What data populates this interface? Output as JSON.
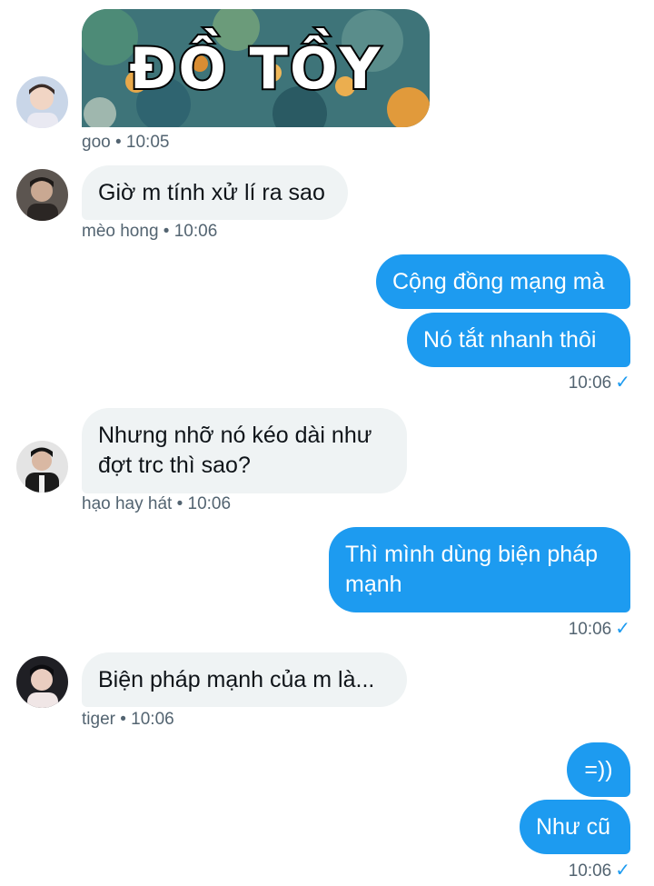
{
  "colors": {
    "outgoing_bubble": "#1d9bf0",
    "incoming_bubble": "#eff3f4",
    "meta_text": "#536471",
    "read_check": "#1d9bf0"
  },
  "messages": [
    {
      "kind": "sticker",
      "sender": "goo",
      "sticker_text": "ĐỒ TỒY",
      "meta": "goo • 10:05",
      "avatar_icon": "user-avatar-icon"
    },
    {
      "kind": "incoming",
      "sender": "mèo hong",
      "text": "Giờ m tính xử lí ra sao",
      "meta": "mèo hong • 10:06",
      "avatar_icon": "user-avatar-icon"
    },
    {
      "kind": "outgoing",
      "text": "Cộng đồng mạng mà"
    },
    {
      "kind": "outgoing",
      "text": "Nó tắt nhanh thôi",
      "time": "10:06",
      "status_icon": "check-icon"
    },
    {
      "kind": "incoming",
      "sender": "hạo hay hát",
      "text_line1": "Nhưng nhỡ nó kéo dài như",
      "text_line2": "đợt trc thì sao?",
      "meta": "hạo hay hát • 10:06",
      "avatar_icon": "user-avatar-icon"
    },
    {
      "kind": "outgoing",
      "text_line1": "Thì mình dùng biện pháp",
      "text_line2": "mạnh",
      "time": "10:06",
      "status_icon": "check-icon"
    },
    {
      "kind": "incoming",
      "sender": "tiger",
      "text": "Biện pháp mạnh của m là...",
      "meta": "tiger • 10:06",
      "avatar_icon": "user-avatar-icon"
    },
    {
      "kind": "outgoing",
      "text": "=))"
    },
    {
      "kind": "outgoing",
      "text": "Như cũ",
      "time": "10:06",
      "status_icon": "check-icon"
    }
  ]
}
